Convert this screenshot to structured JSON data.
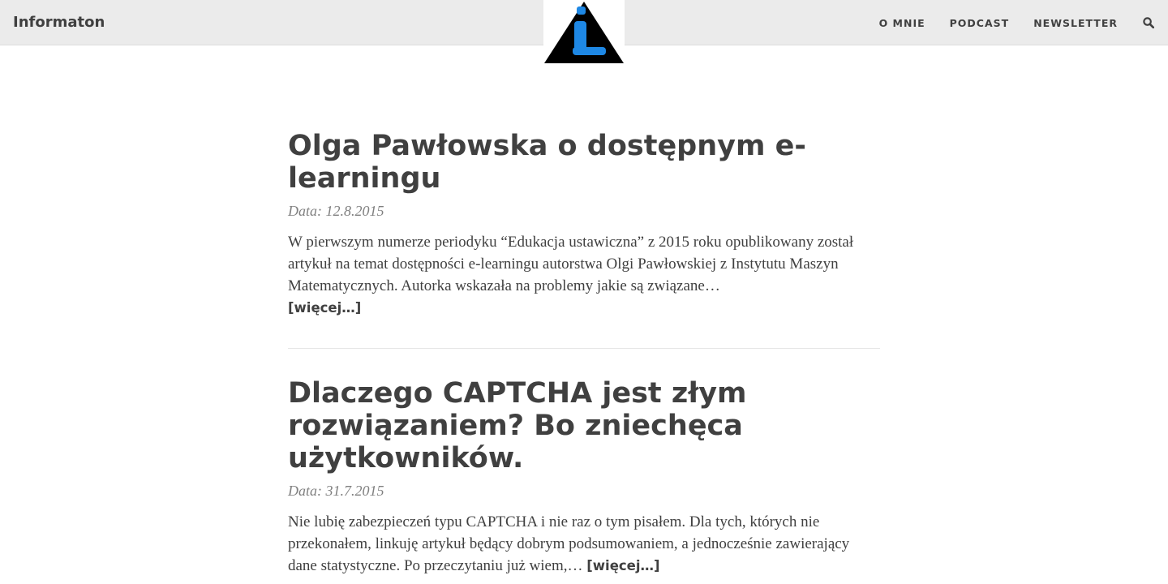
{
  "header": {
    "brand": "Informaton",
    "logo_icon": "info-triangle-icon",
    "nav": [
      {
        "label": "O MNIE"
      },
      {
        "label": "PODCAST"
      },
      {
        "label": "NEWSLETTER"
      }
    ],
    "search_icon": "search-icon"
  },
  "posts": [
    {
      "title": "Olga Pawłowska o dostępnym e-learningu",
      "date": "Data: 12.8.2015",
      "excerpt": "W pierwszym numerze periodyku “Edukacja ustawiczna” z 2015 roku opublikowany został artykuł na temat dostępności e-learningu autorstwa Olgi Pawłowskiej z Instytutu Maszyn Matematycznych. Autorka wskazała na problemy jakie są związane…",
      "more": "[więcej…]"
    },
    {
      "title": "Dlaczego CAPTCHA jest złym rozwiązaniem? Bo zniechęca użytkowników.",
      "date": "Data: 31.7.2015",
      "excerpt": "Nie lubię zabezpieczeń typu CAPTCHA i nie raz o tym pisałem. Dla tych, których nie przekonałem, linkuję artykuł będący dobrym podsumowaniem, a jednocześnie zawierający dane statystyczne. Po przeczytaniu już wiem,…",
      "more": "[więcej…]"
    }
  ],
  "colors": {
    "header_bg": "#ebebeb",
    "text": "#404040",
    "meta": "#808080",
    "logo_blue": "#1e88e5"
  }
}
